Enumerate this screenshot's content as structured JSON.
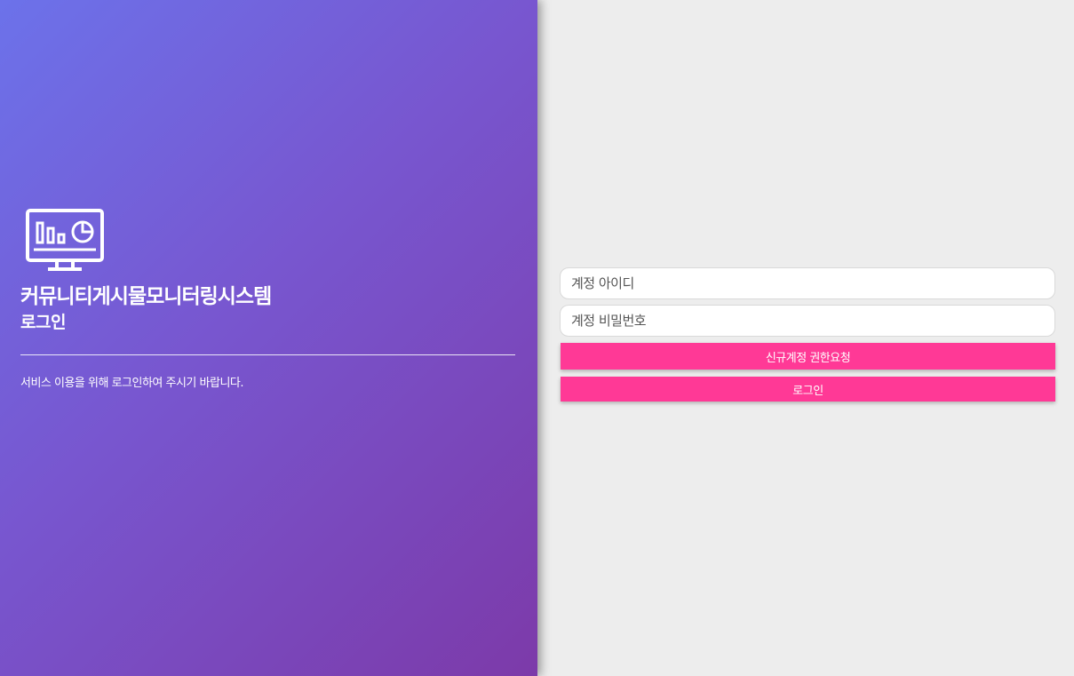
{
  "brand": {
    "title": "커뮤니티게시물모니터링시스템",
    "subtitle": "로그인",
    "icon": "monitor-chart-icon"
  },
  "welcome_message": "서비스 이용을 위해 로그인하여 주시기 바랍니다.",
  "form": {
    "id_placeholder": "계정 아이디",
    "password_placeholder": "계정 비밀번호",
    "request_button": "신규계정 권한요청",
    "login_button": "로그인"
  },
  "colors": {
    "gradient_start": "#6c72ea",
    "gradient_end": "#7c3aa9",
    "accent": "#ff3996",
    "background": "#ededed"
  }
}
